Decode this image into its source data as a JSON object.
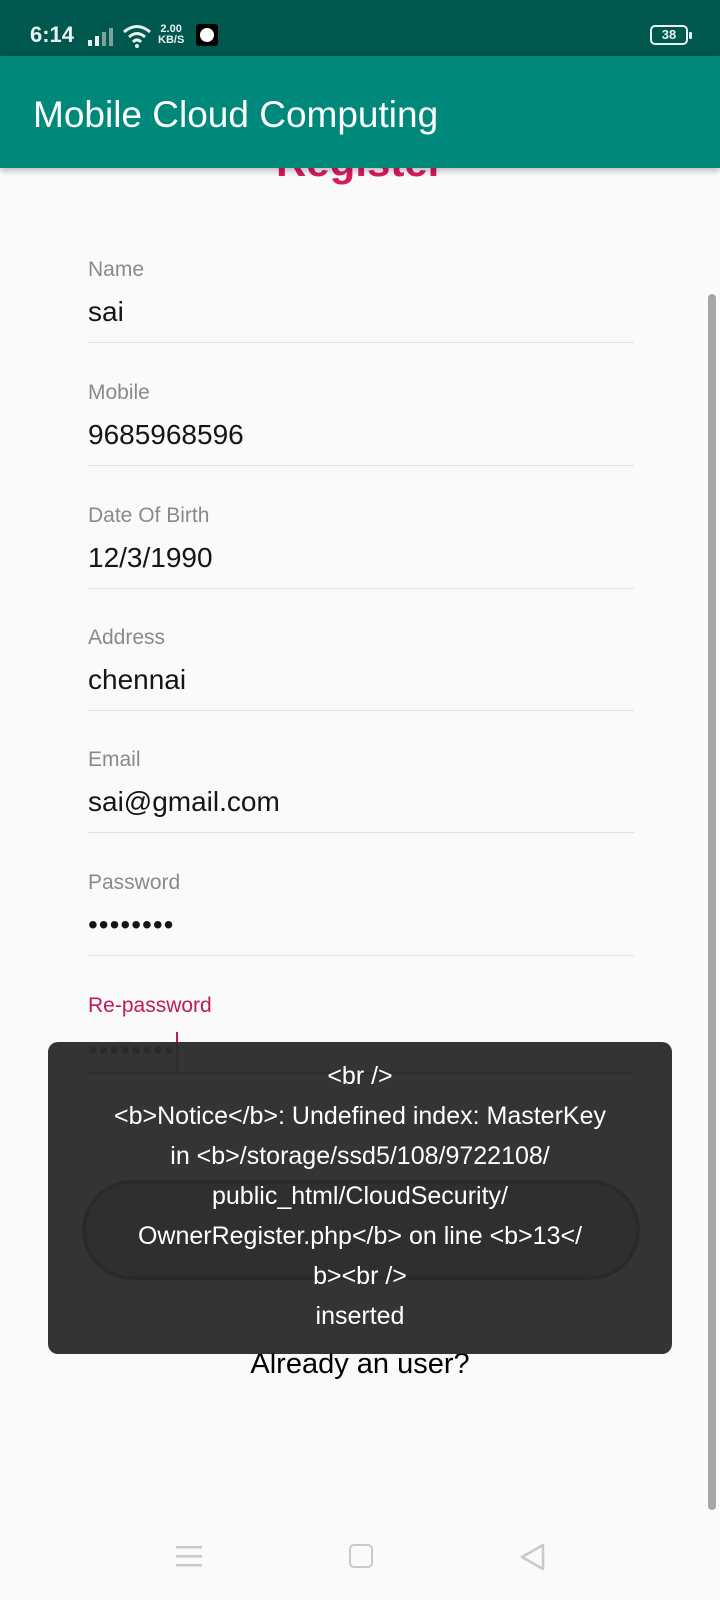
{
  "status_bar": {
    "time": "6:14",
    "net_speed_value": "2.00",
    "net_speed_unit": "KB/S",
    "battery": "38",
    "icons": [
      "signal-icon",
      "wifi-icon",
      "app-badge-icon",
      "battery-icon"
    ]
  },
  "app_bar": {
    "title": "Mobile Cloud Computing"
  },
  "page": {
    "heading": "Register"
  },
  "form": {
    "fields": [
      {
        "label": "Name",
        "value": "sai"
      },
      {
        "label": "Mobile",
        "value": "9685968596"
      },
      {
        "label": "Date Of Birth",
        "value": "12/3/1990"
      },
      {
        "label": "Address",
        "value": "chennai"
      },
      {
        "label": "Email",
        "value": "sai@gmail.com"
      },
      {
        "label": "Password",
        "value": "••••••••"
      },
      {
        "label": "Re-password",
        "value": "••••••••"
      }
    ]
  },
  "footer": {
    "already_user": "Already an user?"
  },
  "toast": {
    "lines": [
      "<br />",
      "<b>Notice</b>:  Undefined index: MasterKey",
      "in <b>/storage/ssd5/108/9722108/",
      "public_html/CloudSecurity/",
      "OwnerRegister.php</b> on line <b>13</",
      "b><br />",
      "inserted"
    ]
  },
  "colors": {
    "status_bar": "#00574d",
    "app_bar": "#00897b",
    "accent": "#d81b60",
    "focused_field": "#c2185b",
    "toast_bg": "#2c2c2c"
  },
  "nav_bar": {
    "icons": [
      "menu-nav-icon",
      "home-nav-icon",
      "back-nav-icon"
    ]
  }
}
